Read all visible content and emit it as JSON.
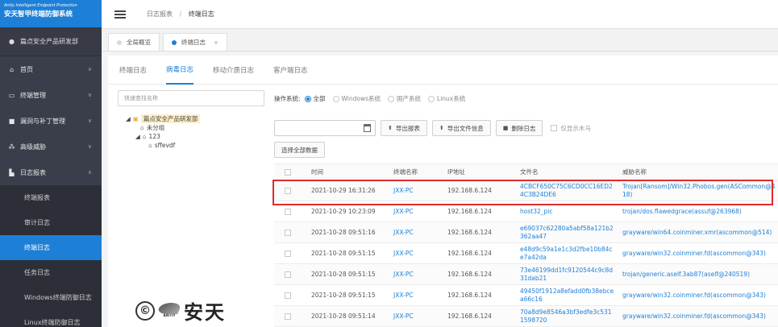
{
  "brand": {
    "en": "Antiy Intelligent Endpoint Protection",
    "cn": "安天智甲终端防御系统"
  },
  "sidebar": {
    "dept": "篇点安全产品研发部",
    "items": [
      {
        "label": "首页",
        "icon": "home-icon"
      },
      {
        "label": "终端管理",
        "icon": "monitor-icon"
      },
      {
        "label": "漏洞与补丁管理",
        "icon": "lock-icon"
      },
      {
        "label": "高级威胁",
        "icon": "network-icon"
      },
      {
        "label": "日志报表",
        "icon": "chart-icon"
      }
    ],
    "sub_items": [
      "终端报表",
      "审计日志",
      "终端日志",
      "任务日志",
      "Windows终端防御日志",
      "Linux终端防御日志"
    ]
  },
  "topbar": {
    "crumb_parent": "日志报表",
    "crumb_sep": "/",
    "crumb_current": "终端日志"
  },
  "page_tabs": [
    {
      "label": "全局概览"
    },
    {
      "label": "终端日志",
      "close": "×"
    }
  ],
  "subtabs": [
    "终端日志",
    "病毒日志",
    "移动介质日志",
    "客户端日志"
  ],
  "tree": {
    "search_placeholder": "快速查找名称",
    "root": "篇点安全产品研发部",
    "children": [
      "未分组",
      "123"
    ],
    "grandchild": "sffevdf"
  },
  "filters": {
    "label": "操作系统:",
    "options": [
      "全部",
      "Windows系统",
      "国产系统",
      "Linux系统"
    ]
  },
  "toolbar": {
    "export_report": "导出报表",
    "export_file": "导出文件信息",
    "delete_log": "删除日志",
    "only_trojan": "仅显示木马",
    "select_all": "选择全部数据"
  },
  "table": {
    "headers": [
      "时间",
      "终端名称",
      "IP地址",
      "文件名",
      "威胁名称"
    ],
    "rows": [
      {
        "time": "2021-10-29 16:31:26",
        "host": "JXX-PC",
        "ip": "192.168.6.124",
        "file": "4CBCF650C75C6CD0CC16ED24C3B24DE6",
        "threat": "Trojan[Ransom]/Win32.Phobos.gen(ASCommon@418)"
      },
      {
        "time": "2021-10-29 10:23:09",
        "host": "JXX-PC",
        "ip": "192.168.6.124",
        "file": "host32_pic",
        "threat": "trojan/dos.flawedgrace(assuf@263968)"
      },
      {
        "time": "2021-10-28 09:51:16",
        "host": "JXX-PC",
        "ip": "192.168.6.124",
        "file": "e69037c62280a5abf58a121b2362aa47",
        "threat": "grayware/win64.coinminer.xmr(ascommon@514)"
      },
      {
        "time": "2021-10-28 09:51:15",
        "host": "JXX-PC",
        "ip": "192.168.6.124",
        "file": "e48d9c59a1e1c3d2fbe10b84ce7a42da",
        "threat": "grayware/win32.coinminer.fd(ascommon@343)"
      },
      {
        "time": "2021-10-28 09:51:15",
        "host": "JXX-PC",
        "ip": "192.168.6.124",
        "file": "73e46199dd1fc9120544c9c8d31dab21",
        "threat": "trojan/generic.aself.3ab87(aself@240519)"
      },
      {
        "time": "2021-10-28 09:51:15",
        "host": "JXX-PC",
        "ip": "192.168.6.124",
        "file": "49450f1912a8efadd0fb38ebcea66c16",
        "threat": "grayware/win32.coinminer.fd(ascommon@343)"
      },
      {
        "time": "2021-10-28 09:51:14",
        "host": "JXX-PC",
        "ip": "192.168.6.124",
        "file": "70a8d9e8546a3bf3edfe3c5311598720",
        "threat": "grayware/win32.coinminer.fd(ascommon@343)"
      }
    ]
  },
  "watermark": {
    "symbol": "©",
    "logo_sub": "ANTIY",
    "text": "安天"
  },
  "colors": {
    "accent": "#1e7fd6",
    "sidebar": "#3a3e4a",
    "highlight": "#e02b2b"
  }
}
